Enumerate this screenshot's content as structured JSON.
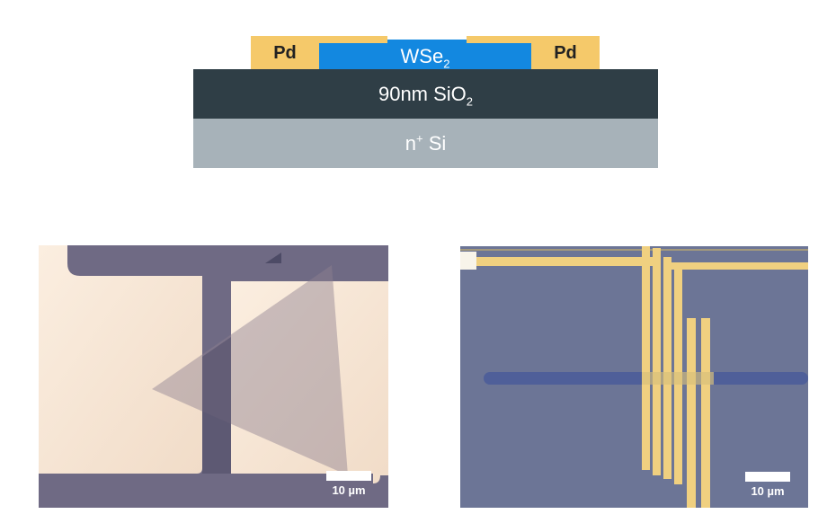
{
  "stack": {
    "pd_left": "Pd",
    "pd_right": "Pd",
    "channel_main": "WSe",
    "channel_sub": "2",
    "oxide_main": "90nm SiO",
    "oxide_sub": "2",
    "substrate_pre": "n",
    "substrate_sup": "+",
    "substrate_post": " Si"
  },
  "micrograph_left": {
    "scale_label": "10 µm"
  },
  "micrograph_right": {
    "scale_label": "10 µm"
  },
  "colors": {
    "pd": "#f5c96a",
    "wse2": "#1388e0",
    "sio2": "#2f3e46",
    "si": "#a7b2b9",
    "substrate_purple": "#6f6a84",
    "metal_pad": "#f6e8d8",
    "gold_electrode": "#f0d080",
    "substrate_blue": "#6c7596"
  }
}
